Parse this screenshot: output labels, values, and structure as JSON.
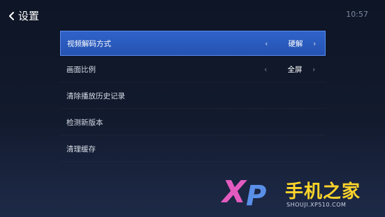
{
  "header": {
    "title": "设置",
    "time": "10:57"
  },
  "menu": {
    "items": [
      {
        "label": "视频解码方式",
        "value": "硬解",
        "selected": true
      },
      {
        "label": "画面比例",
        "value": "全屏",
        "selected": false
      },
      {
        "label": "清除播放历史记录"
      },
      {
        "label": "检测新版本"
      },
      {
        "label": "清理缓存"
      }
    ]
  },
  "watermark": {
    "logo_text": "XP",
    "brand": "手机之家",
    "url": "SHOUJI.XP510.COM"
  },
  "icons": {
    "back": "chevron-left-icon",
    "prev": "chevron-left-icon",
    "next": "chevron-right-icon"
  },
  "colors": {
    "selected_row": "#2f62c9",
    "selected_border": "#5c8cf0",
    "background": "#121a2d"
  }
}
